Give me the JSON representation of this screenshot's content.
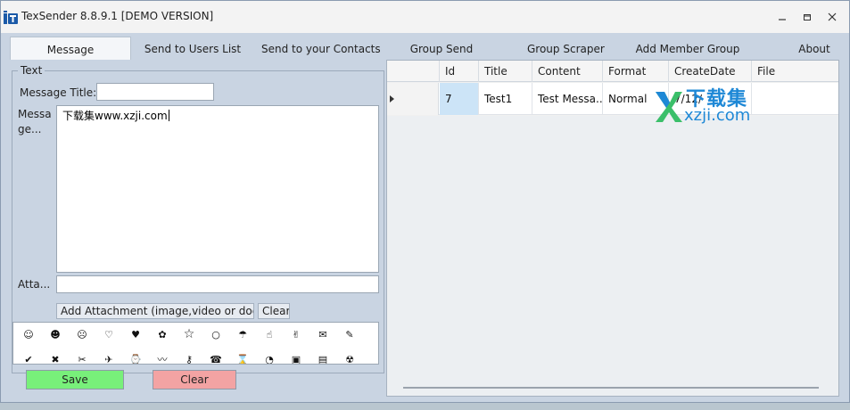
{
  "window": {
    "title": "TexSender 8.8.9.1 [DEMO VERSION]",
    "controls": [
      "minimize",
      "restore",
      "close"
    ]
  },
  "tabs": [
    {
      "label": "Message",
      "active": true
    },
    {
      "label": "Send to Users List"
    },
    {
      "label": "Send to your Contacts"
    },
    {
      "label": "Group Send"
    },
    {
      "label": "Group Scraper"
    },
    {
      "label": "Add Member Group"
    },
    {
      "label": "About"
    }
  ],
  "message_panel": {
    "group_label": "Text",
    "title_label": "Message Title:",
    "title_value": "",
    "message_label_1": "Messa",
    "message_label_2": "ge...",
    "message_value": "下载集www.xzji.com",
    "attach_label": "Atta...",
    "attach_value": "",
    "add_attachment_label": "Add  Attachment  (image,video  or doc...",
    "clear_attachment_label": "Clear",
    "emoji_icons": [
      "smile-face-icon",
      "grin-face-icon",
      "sad-face-icon",
      "heart-outline-icon",
      "heart-icon",
      "flower-icon",
      "star-outline-icon",
      "circle-icon",
      "umbrella-icon",
      "hand-icon",
      "peace-hand-icon",
      "envelope-icon",
      "pencil-icon",
      "check-icon",
      "cross-icon",
      "scissors-icon",
      "airplane-icon",
      "clock-icon",
      "squiggle-icon",
      "key-icon",
      "telephone-icon",
      "hourglass-icon",
      "stopwatch-icon",
      "floppy-icon",
      "film-icon",
      "radioactive-icon"
    ],
    "save_label": "Save",
    "clear_label": "Clear"
  },
  "grid": {
    "columns": [
      "Id",
      "Title",
      "Content",
      "Format",
      "CreateDate",
      "File"
    ],
    "rows": [
      {
        "Id": "7",
        "Title": "Test1",
        "Content": "Test Messa...",
        "Format": "Normal",
        "CreateDate": "7/12/",
        "File": ""
      }
    ]
  },
  "watermark": {
    "text_cn": "下载集",
    "text_en": "xzji.com"
  },
  "colors": {
    "save": "#78f07a",
    "clear": "#f3a3a3",
    "selection": "#cce4f7",
    "watermark": "#1e88d6"
  }
}
